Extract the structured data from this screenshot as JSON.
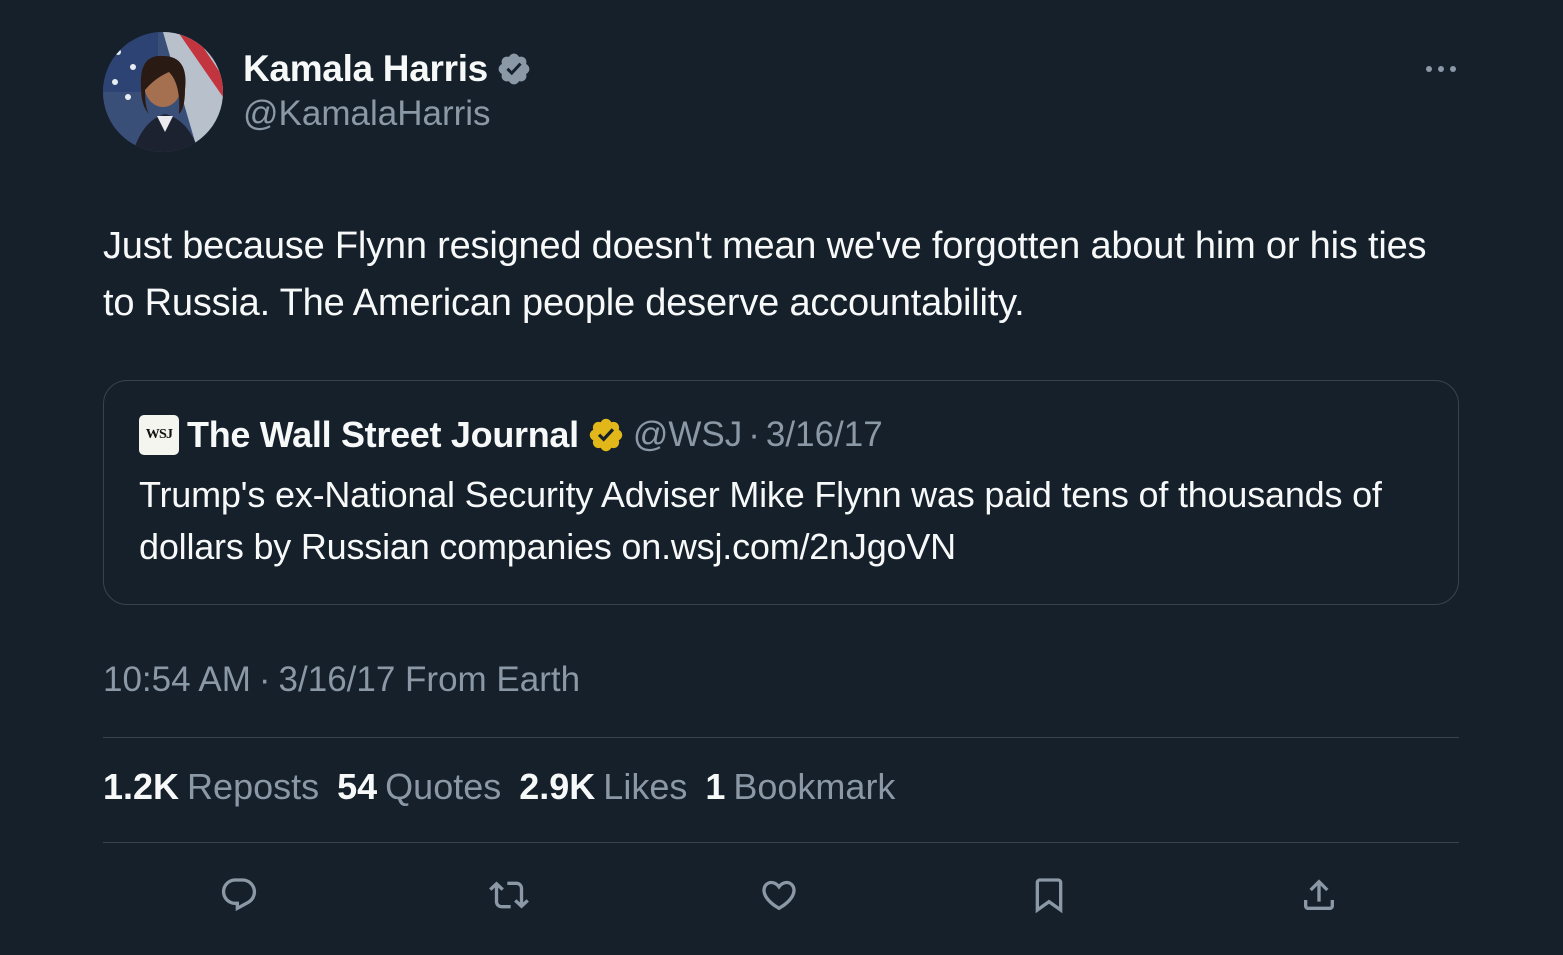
{
  "author": {
    "display_name": "Kamala Harris",
    "handle": "@KamalaHarris",
    "verified_icon": "blue-verified-badge",
    "avatar": "profile-photo"
  },
  "tweet": {
    "text": "Just because Flynn resigned doesn't mean we've forgotten about him or his ties to Russia. The American people deserve accountability."
  },
  "quote": {
    "logo_text": "WSJ",
    "display_name": "The Wall Street Journal",
    "verified_icon": "gold-verified-badge",
    "handle": "@WSJ",
    "separator": "·",
    "date": "3/16/17",
    "text": "Trump's ex-National Security Adviser Mike Flynn was paid tens of thousands of dollars by Russian companies on.wsj.com/2nJgoVN"
  },
  "meta": {
    "time": "10:54 AM",
    "separator": "·",
    "date_source": "3/16/17 From Earth"
  },
  "stats": {
    "reposts_count": "1.2K",
    "reposts_label": "Reposts",
    "quotes_count": "54",
    "quotes_label": "Quotes",
    "likes_count": "2.9K",
    "likes_label": "Likes",
    "bookmarks_count": "1",
    "bookmarks_label": "Bookmark"
  },
  "actions": [
    "reply-icon",
    "repost-icon",
    "like-icon",
    "bookmark-icon",
    "share-icon"
  ],
  "colors": {
    "background": "#15202b",
    "primary_text": "#f7f9f9",
    "secondary_text": "#8b98a5",
    "border": "#38444d",
    "verified_blue": "#8b98a5",
    "verified_gold": "#e2b719"
  }
}
